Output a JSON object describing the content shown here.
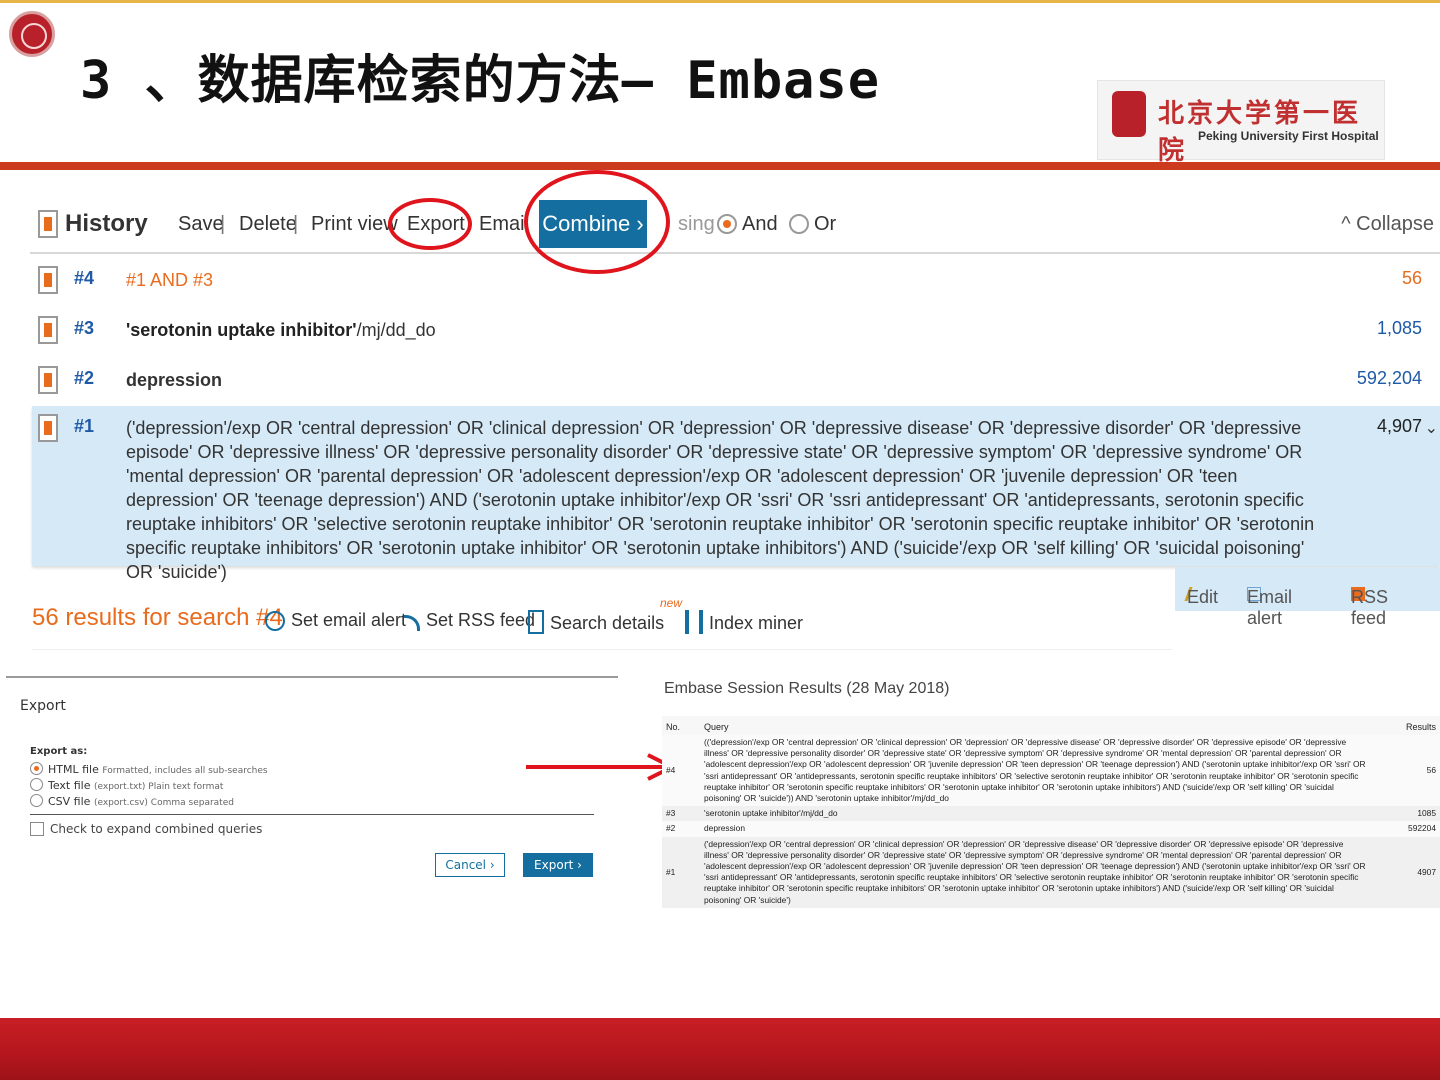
{
  "slide": {
    "title": "3 、数据库检索的方法— Embase",
    "logo_cn": "北京大学第一医院",
    "logo_en": "Peking University First Hospital"
  },
  "history": {
    "title": "History",
    "tools": [
      "Save",
      "Delete",
      "Print view",
      "Export",
      "Email"
    ],
    "separator": "|",
    "combine_label": "Combine ›",
    "using_label": "sing",
    "and_label": "And",
    "or_label": "Or",
    "collapse_label": "^ Collapse",
    "rows": [
      {
        "id": "#4",
        "query": "#1 AND #3",
        "count": "56"
      },
      {
        "id": "#3",
        "query_bold": "'serotonin uptake inhibitor'",
        "query_rest": "/mj/dd_do",
        "count": "1,085"
      },
      {
        "id": "#2",
        "query": "depression",
        "count": "592,204"
      },
      {
        "id": "#1",
        "query": "('depression'/exp OR 'central depression' OR 'clinical depression' OR 'depression' OR 'depressive disease' OR 'depressive disorder' OR 'depressive episode' OR 'depressive illness' OR 'depressive personality disorder' OR 'depressive state' OR 'depressive symptom' OR 'depressive syndrome' OR 'mental depression' OR 'parental depression' OR 'adolescent depression'/exp OR 'adolescent depression' OR 'juvenile depression' OR 'teen depression' OR 'teenage depression') AND ('serotonin uptake inhibitor'/exp OR 'ssri' OR 'ssri antidepressant' OR 'antidepressants, serotonin specific reuptake inhibitors' OR 'selective serotonin reuptake inhibitor' OR 'serotonin reuptake inhibitor' OR 'serotonin specific reuptake inhibitor' OR 'serotonin specific reuptake inhibitors' OR 'serotonin uptake inhibitor' OR 'serotonin uptake inhibitors') AND ('suicide'/exp OR 'self killing' OR 'suicidal poisoning' OR 'suicide')",
        "count": "4,907"
      }
    ],
    "row_actions": {
      "edit": "Edit",
      "email_alert": "Email alert",
      "rss": "RSS feed"
    }
  },
  "results_bar": {
    "count_text": "56 results for search #4",
    "set_email_alert": "Set email alert",
    "set_rss_feed": "Set RSS feed",
    "search_details": "Search details",
    "new_tag": "new",
    "index_miner": "Index miner"
  },
  "export_dialog": {
    "title": "Export",
    "export_as": "Export as:",
    "options": [
      {
        "label": "HTML file",
        "desc": "Formatted, includes all sub-searches",
        "selected": true
      },
      {
        "label": "Text file",
        "desc": "(export.txt) Plain text format",
        "selected": false
      },
      {
        "label": "CSV file",
        "desc": "(export.csv) Comma separated",
        "selected": false
      }
    ],
    "expand_label": "Check to expand combined queries",
    "cancel_label": "Cancel ›",
    "export_label": "Export ›"
  },
  "session": {
    "title": "Embase Session Results (28 May 2018)",
    "col_no": "No.",
    "col_query": "Query",
    "col_results": "Results",
    "rows": [
      {
        "no": "#4",
        "query": "(('depression'/exp OR 'central depression' OR 'clinical depression' OR 'depression' OR 'depressive disease' OR 'depressive disorder' OR 'depressive episode' OR 'depressive illness' OR 'depressive personality disorder' OR 'depressive state' OR 'depressive symptom' OR 'depressive syndrome' OR 'mental depression' OR 'parental depression' OR 'adolescent depression'/exp OR 'adolescent depression' OR 'juvenile depression' OR 'teen depression' OR 'teenage depression') AND ('serotonin uptake inhibitor'/exp OR 'ssri' OR 'ssri antidepressant' OR 'antidepressants, serotonin specific reuptake inhibitors' OR 'selective serotonin reuptake inhibitor' OR 'serotonin reuptake inhibitor' OR 'serotonin specific reuptake inhibitor' OR 'serotonin specific reuptake inhibitors' OR 'serotonin uptake inhibitor' OR 'serotonin uptake inhibitors') AND ('suicide'/exp OR 'self killing' OR 'suicidal poisoning' OR 'suicide')) AND 'serotonin uptake inhibitor'/mj/dd_do",
        "results": "56"
      },
      {
        "no": "#3",
        "query": "'serotonin uptake inhibitor'/mj/dd_do",
        "results": "1085"
      },
      {
        "no": "#2",
        "query": "depression",
        "results": "592204"
      },
      {
        "no": "#1",
        "query": "('depression'/exp OR 'central depression' OR 'clinical depression' OR 'depression' OR 'depressive disease' OR 'depressive disorder' OR 'depressive episode' OR 'depressive illness' OR 'depressive personality disorder' OR 'depressive state' OR 'depressive symptom' OR 'depressive syndrome' OR 'mental depression' OR 'parental depression' OR 'adolescent depression'/exp OR 'adolescent depression' OR 'juvenile depression' OR 'teen depression' OR 'teenage depression') AND ('serotonin uptake inhibitor'/exp OR 'ssri' OR 'ssri antidepressant' OR 'antidepressants, serotonin specific reuptake inhibitors' OR 'selective serotonin reuptake inhibitor' OR 'serotonin reuptake inhibitor' OR 'serotonin specific reuptake inhibitor' OR 'serotonin specific reuptake inhibitors' OR 'serotonin uptake inhibitor' OR 'serotonin uptake inhibitors') AND ('suicide'/exp OR 'self killing' OR 'suicidal poisoning' OR 'suicide')",
        "results": "4907"
      }
    ]
  },
  "colors": {
    "accent_orange": "#e86b1e",
    "brand_blue": "#146fa0",
    "header_rule": "#cc3b1d",
    "annotation_red": "#e0141c",
    "selected_row": "#d5e9f7"
  },
  "icons": {
    "alarm": "alarm-clock-icon",
    "rss": "rss-icon",
    "details": "document-icon",
    "index_miner": "bar-chart-icon",
    "edit": "pencil-icon",
    "email": "envelope-icon"
  }
}
